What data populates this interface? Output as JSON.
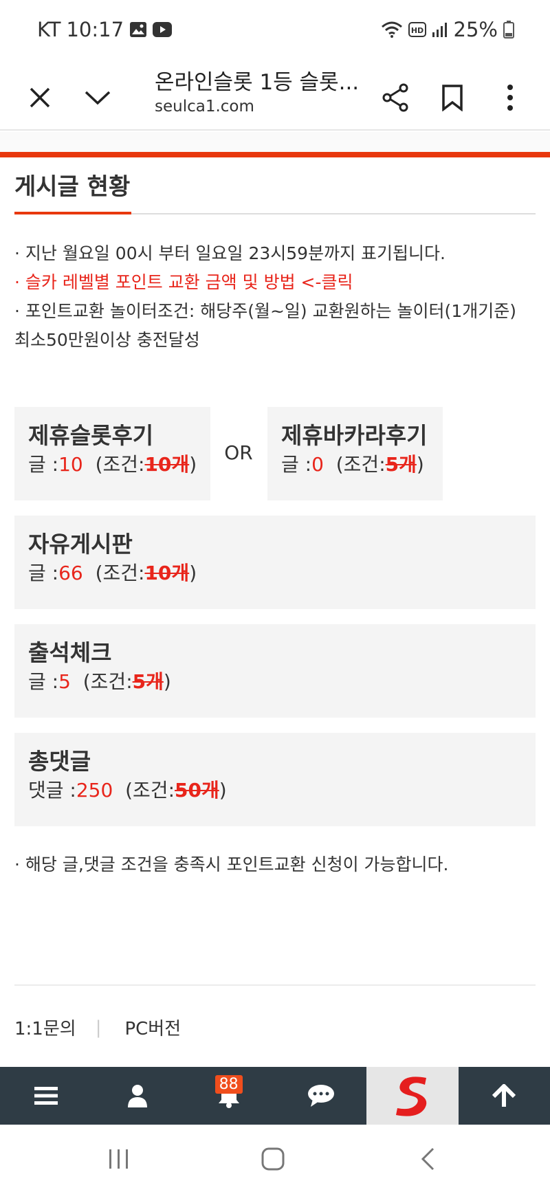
{
  "status_bar": {
    "carrier": "KT",
    "time": "10:17",
    "battery": "25%",
    "icons": [
      "gallery-icon",
      "youtube-icon",
      "wifi-icon",
      "hd-icon",
      "signal-icon",
      "battery-icon"
    ]
  },
  "app_bar": {
    "title": "온라인슬롯 1등 슬롯...",
    "url": "seulca1.com"
  },
  "section": {
    "title": "게시글 현황"
  },
  "notes": {
    "line1": "· 지난 월요일 00시 부터 일요일 23시59분까지 표기됩니다.",
    "line2": "· 슬카 레벨별 포인트 교환 금액 및 방법 <-클릭",
    "line3": "· 포인트교환 놀이터조건: 해당주(월~일) 교환원하는 놀이터(1개기준) 최소50만원이상 충전달성"
  },
  "or_label": "OR",
  "boxes": {
    "slot": {
      "title": "제휴슬롯후기",
      "label": "글 :",
      "count": "10",
      "cond_prefix": "(조건:",
      "cond": "10개",
      "cond_suffix": ")"
    },
    "baccarat": {
      "title": "제휴바카라후기",
      "label": "글 :",
      "count": "0",
      "cond_prefix": "(조건:",
      "cond": "5개",
      "cond_suffix": ")"
    },
    "free": {
      "title": "자유게시판",
      "label": "글 :",
      "count": "66",
      "cond_prefix": "(조건:",
      "cond": "10개",
      "cond_suffix": ")"
    },
    "attendance": {
      "title": "출석체크",
      "label": "글 :",
      "count": "5",
      "cond_prefix": "(조건:",
      "cond": "5개",
      "cond_suffix": ")"
    },
    "comments": {
      "title": "총댓글",
      "label": "댓글 :",
      "count": "250",
      "cond_prefix": "(조건:",
      "cond": "50개",
      "cond_suffix": ")"
    }
  },
  "footer_note": "· 해당 글,댓글 조건을 충족시 포인트교환 신청이 가능합니다.",
  "links": {
    "inquiry": "1:1문의",
    "separator": "|",
    "pc": "PC버전"
  },
  "bottom_nav": {
    "badge": "88"
  },
  "colors": {
    "accent": "#e8380d",
    "red": "#e8251b",
    "nav_bg": "#2f3c45"
  }
}
